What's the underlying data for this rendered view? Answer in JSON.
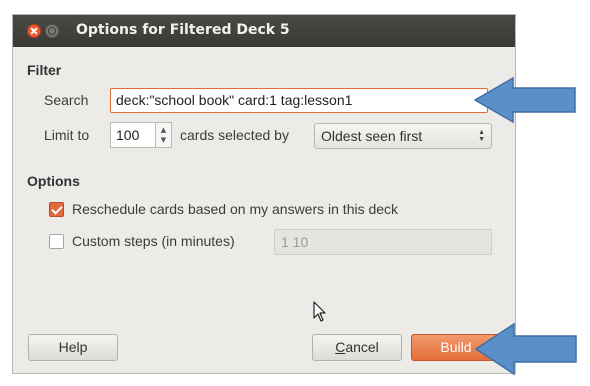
{
  "window": {
    "title": "Options for Filtered Deck 5"
  },
  "filter": {
    "section_label": "Filter",
    "search_label": "Search",
    "search_value": "deck:\"school book\" card:1 tag:lesson1",
    "limit_label": "Limit to",
    "limit_value": "100",
    "selected_by_label": "cards selected by",
    "order_value": "Oldest seen first"
  },
  "options": {
    "section_label": "Options",
    "reschedule_label": "Reschedule cards based on my answers in this deck",
    "reschedule_checked": true,
    "custom_steps_label": "Custom steps (in minutes)",
    "custom_steps_checked": false,
    "steps_value": "1 10"
  },
  "buttons": {
    "help": "Help",
    "cancel_mnemonic": "C",
    "cancel_rest": "ancel",
    "build": "Build"
  },
  "colors": {
    "accent": "#e36a3c",
    "arrow": "#5b8fc9",
    "titlebar": "#3c3b37"
  }
}
